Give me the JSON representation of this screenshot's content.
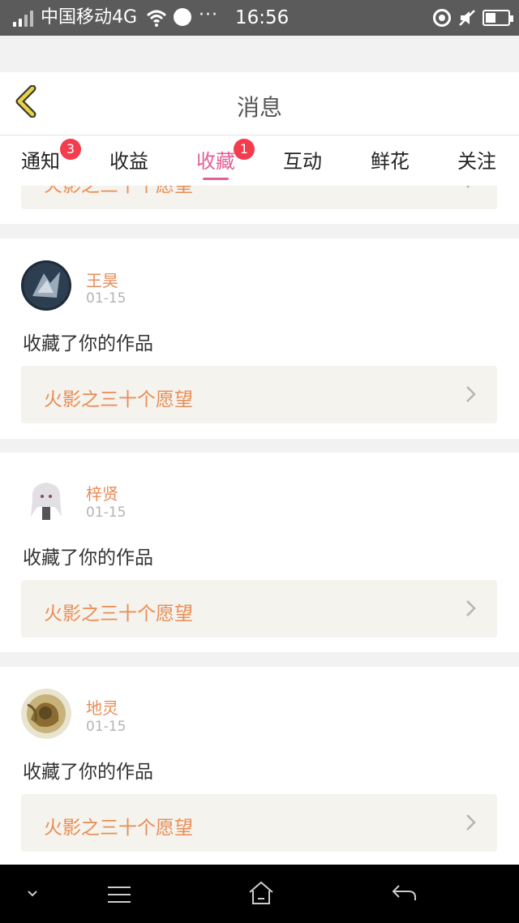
{
  "status_bar": {
    "carrier": "中国移动4G",
    "dots": "···",
    "time": "16:56"
  },
  "header": {
    "back_icon": "chevron-left-icon",
    "title": "消息"
  },
  "tabs": [
    {
      "label": "通知",
      "badge": "3",
      "active": false
    },
    {
      "label": "收益",
      "badge": "",
      "active": false
    },
    {
      "label": "收藏",
      "badge": "1",
      "active": true
    },
    {
      "label": "互动",
      "badge": "",
      "active": false
    },
    {
      "label": "鲜花",
      "badge": "",
      "active": false
    },
    {
      "label": "关注",
      "badge": "",
      "active": false
    }
  ],
  "partial_top": {
    "work_title": "火影之三十个愿望"
  },
  "items": [
    {
      "user": "王昊",
      "date": "01-15",
      "action": "收藏了你的作品",
      "work_title": "火影之三十个愿望"
    },
    {
      "user": "梓贤",
      "date": "01-15",
      "action": "收藏了你的作品",
      "work_title": "火影之三十个愿望"
    },
    {
      "user": "地灵",
      "date": "01-15",
      "action": "收藏了你的作品",
      "work_title": "火影之三十个愿望"
    }
  ],
  "nav_icons": [
    "chevron-down-icon",
    "menu-icon",
    "home-icon",
    "back-arrow-icon"
  ],
  "colors": {
    "accent": "#e35f97",
    "badge": "#f43c4f",
    "link_text": "#e98c56",
    "link_bg": "#f4f3ed",
    "back_icon": "#e8d34a"
  }
}
